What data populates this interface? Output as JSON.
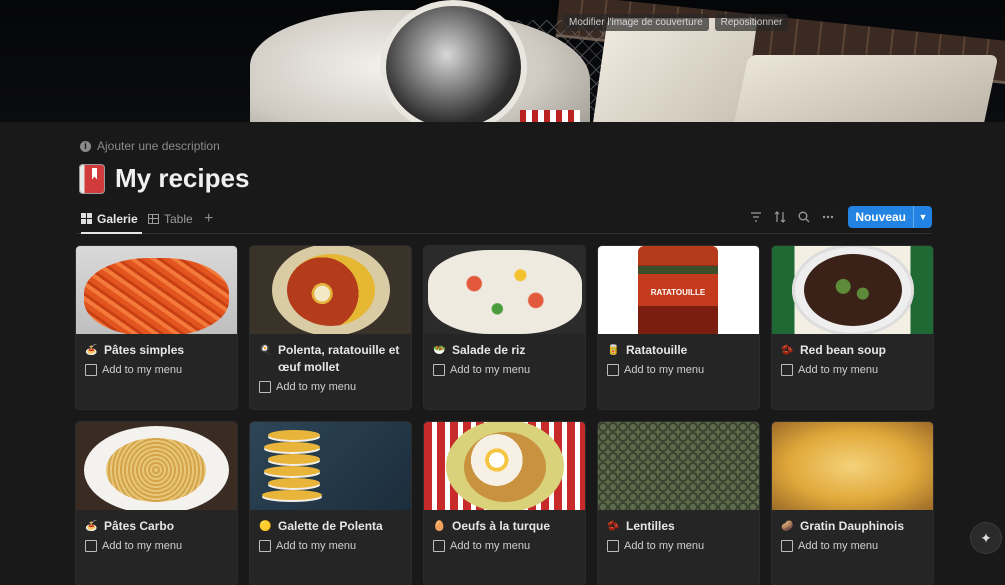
{
  "cover": {
    "change_label": "Modifier l'image de couverture",
    "reposition_label": "Repositionner"
  },
  "header": {
    "add_description": "Ajouter une description",
    "title": "My recipes",
    "icon": "bookmark-book-icon"
  },
  "views": {
    "tabs": [
      {
        "label": "Galerie",
        "icon": "gallery-grid-icon",
        "active": true
      },
      {
        "label": "Table",
        "icon": "table-icon",
        "active": false
      }
    ],
    "add_icon": "plus-icon"
  },
  "toolbar": {
    "icons": [
      "filter-icon",
      "sort-icon",
      "search-icon",
      "more-icon"
    ],
    "new_label": "Nouveau",
    "accent_color": "#2383e2"
  },
  "cards": [
    {
      "name": "Pâtes simples",
      "emoji": "🍝",
      "checkbox_label": "Add to my menu"
    },
    {
      "name": "Polenta, ratatouille et œuf mollet",
      "emoji": "🍳",
      "checkbox_label": "Add to my menu"
    },
    {
      "name": "Salade de riz",
      "emoji": "🥗",
      "checkbox_label": "Add to my menu"
    },
    {
      "name": "Ratatouille",
      "emoji": "🥫",
      "checkbox_label": "Add to my menu"
    },
    {
      "name": "Red bean soup",
      "emoji": "🫘",
      "checkbox_label": "Add to my menu"
    },
    {
      "name": "Pâtes Carbo",
      "emoji": "🍝",
      "checkbox_label": "Add to my menu"
    },
    {
      "name": "Galette de Polenta",
      "emoji": "🟡",
      "checkbox_label": "Add to my menu"
    },
    {
      "name": "Oeufs à la turque",
      "emoji": "🥚",
      "checkbox_label": "Add to my menu"
    },
    {
      "name": "Lentilles",
      "emoji": "🫘",
      "checkbox_label": "Add to my menu"
    },
    {
      "name": "Gratin Dauphinois",
      "emoji": "🥔",
      "checkbox_label": "Add to my menu"
    }
  ],
  "ratatouille_jar_label": "RATATOUILLE",
  "ai_button_icon": "sparkle-icon"
}
